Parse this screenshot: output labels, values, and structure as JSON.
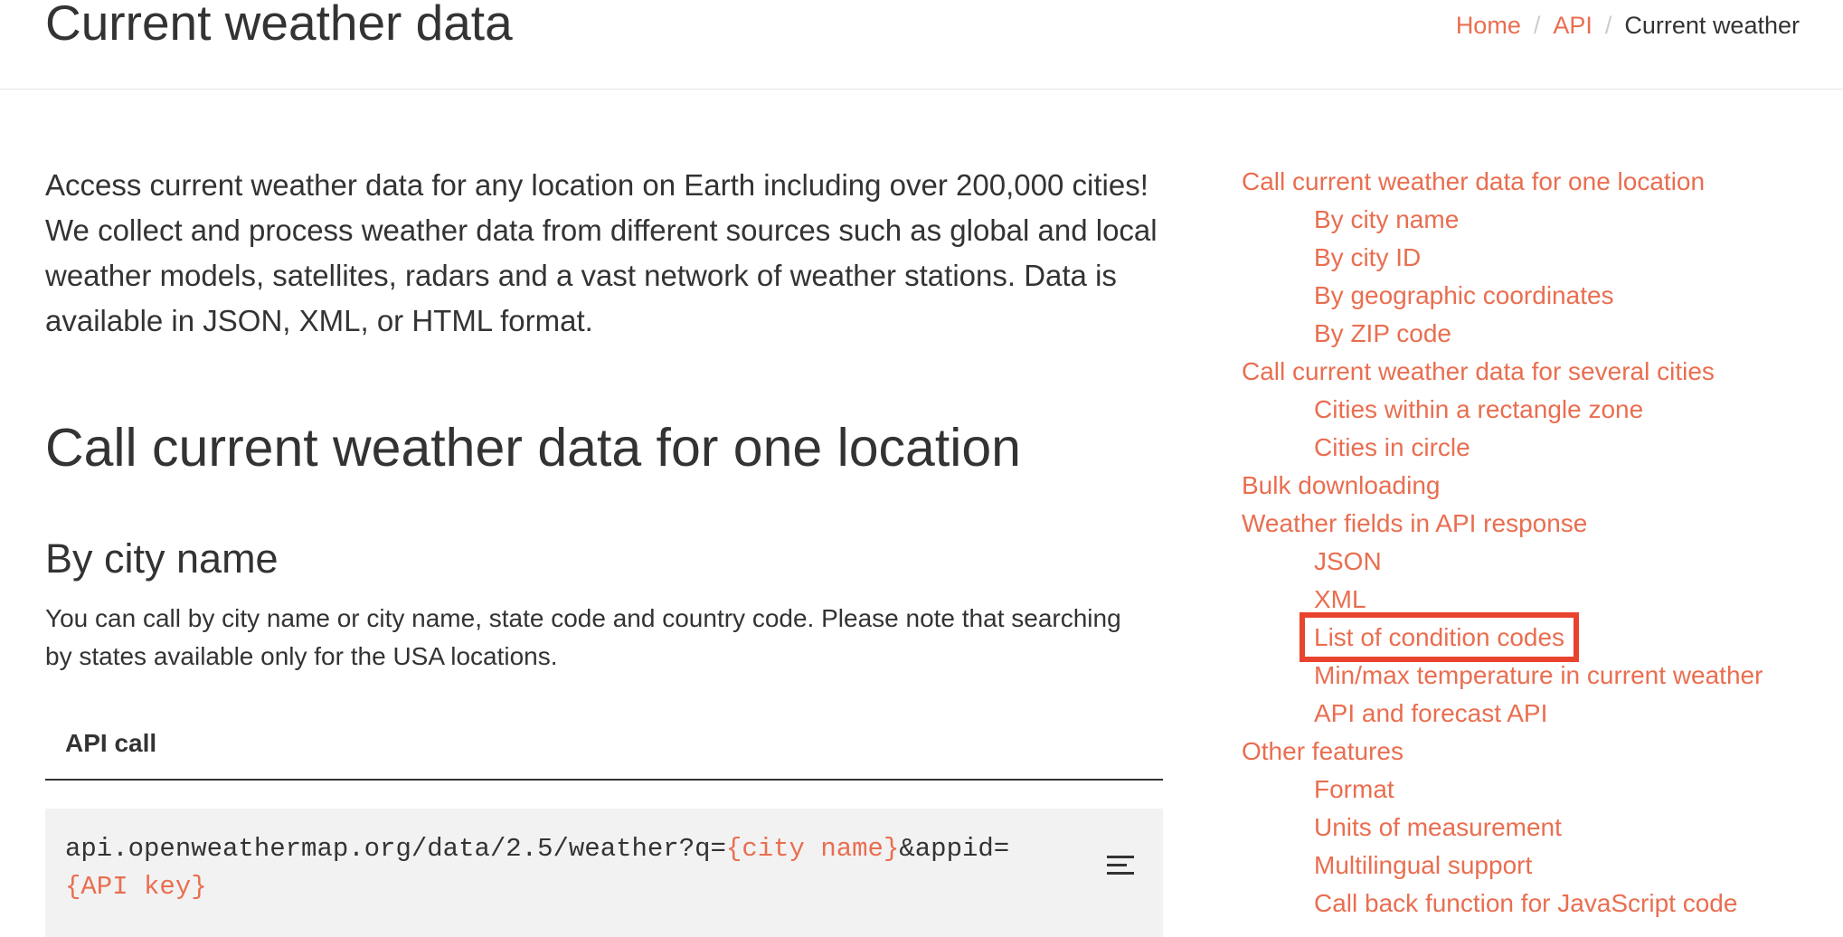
{
  "header": {
    "title": "Current weather data",
    "breadcrumb": {
      "home": "Home",
      "api": "API",
      "current": "Current weather",
      "separator": "/"
    }
  },
  "main": {
    "intro": "Access current weather data for any location on Earth including over 200,000 cities! We collect and process weather data from different sources such as global and local weather models, satellites, radars and a vast network of weather stations. Data is available in JSON, XML, or HTML format.",
    "section_title": "Call current weather data for one location",
    "sub_title": "By city name",
    "sub_desc": "You can call by city name or city name, state code and country code. Please note that searching by states available only for the USA locations.",
    "api_call_label": "API call",
    "code": {
      "prefix": "api.openweathermap.org/data/2.5/weather?q=",
      "param1": "{city name}",
      "middle": "&appid=",
      "param2": "{API key}"
    }
  },
  "toc": {
    "items": [
      {
        "label": "Call current weather data for one location",
        "level": 1
      },
      {
        "label": "By city name",
        "level": 2
      },
      {
        "label": "By city ID",
        "level": 2
      },
      {
        "label": "By geographic coordinates",
        "level": 2
      },
      {
        "label": "By ZIP code",
        "level": 2
      },
      {
        "label": "Call current weather data for several cities",
        "level": 1
      },
      {
        "label": "Cities within a rectangle zone",
        "level": 2
      },
      {
        "label": "Cities in circle",
        "level": 2
      },
      {
        "label": "Bulk downloading",
        "level": 1
      },
      {
        "label": "Weather fields in API response",
        "level": 1
      },
      {
        "label": "JSON",
        "level": 2
      },
      {
        "label": "XML",
        "level": 2
      },
      {
        "label": "List of condition codes",
        "level": 2,
        "highlighted": true
      },
      {
        "label": "Min/max temperature in current weather",
        "level": 2
      },
      {
        "label": "API and forecast API",
        "level": 2
      },
      {
        "label": "Other features",
        "level": 1
      },
      {
        "label": "Format",
        "level": 2
      },
      {
        "label": "Units of measurement",
        "level": 2
      },
      {
        "label": "Multilingual support",
        "level": 2
      },
      {
        "label": "Call back function for JavaScript code",
        "level": 2
      }
    ]
  },
  "colors": {
    "accent": "#e96e50",
    "highlight_box": "#e8432e",
    "text": "#333333",
    "code_bg": "#f2f2f2"
  },
  "icons": {
    "code_menu": "menu-lines-icon"
  }
}
